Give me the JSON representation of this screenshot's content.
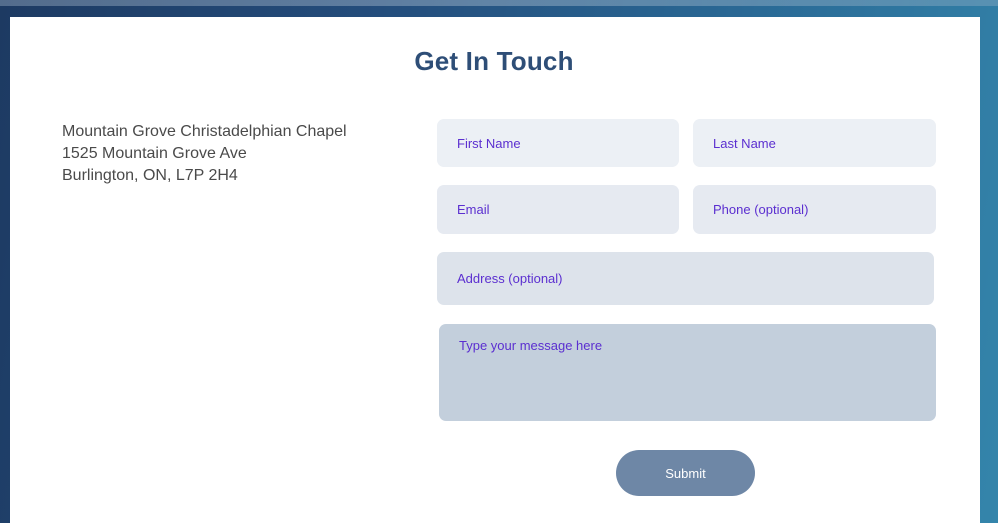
{
  "contact": {
    "title": "Get In Touch",
    "address_lines": [
      "Mountain Grove Christadelphian Chapel",
      "1525 Mountain Grove Ave",
      "Burlington, ON, L7P 2H4"
    ]
  },
  "form": {
    "first_name_placeholder": "First Name",
    "last_name_placeholder": "Last Name",
    "email_placeholder": "Email",
    "phone_placeholder": "Phone (optional)",
    "address_placeholder": "Address (optional)",
    "message_placeholder": "Type your message here",
    "submit_label": "Submit"
  },
  "colors": {
    "title": "#2e4e77",
    "placeholder_text": "#5b2fd0",
    "submit_bg": "#6e87a6",
    "page_bg_dark": "#1d3a62",
    "page_bg_light": "#3485ab"
  }
}
